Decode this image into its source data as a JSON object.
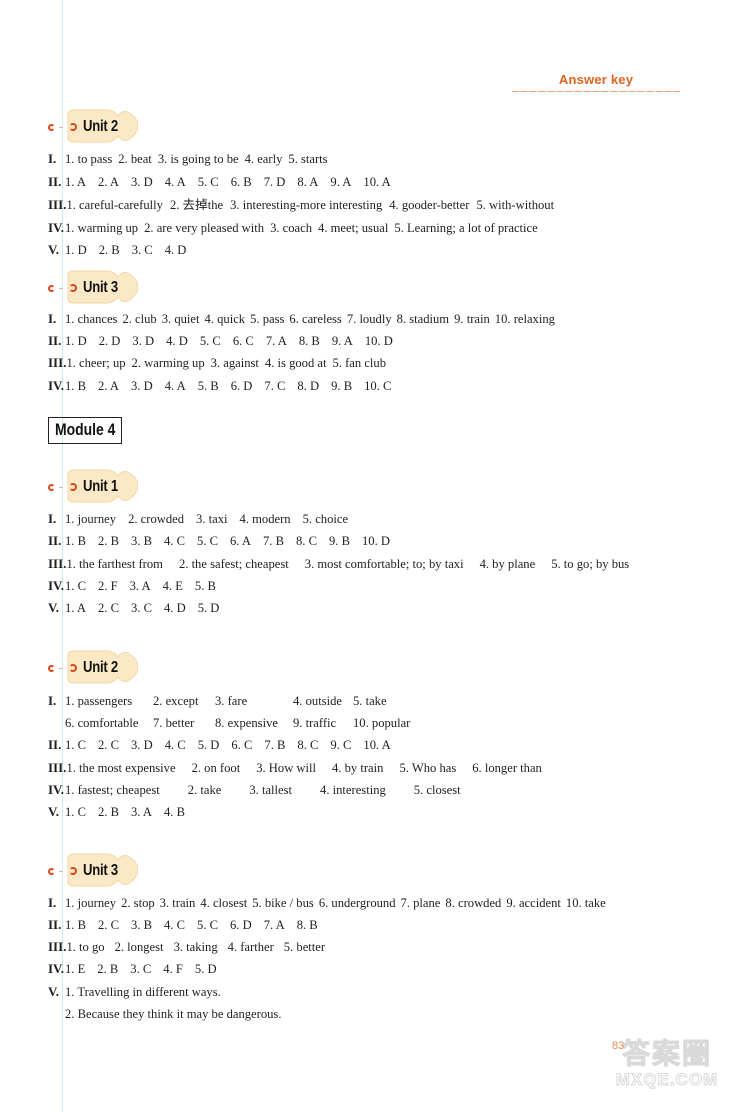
{
  "header": {
    "title": "Answer key"
  },
  "page_number": "83",
  "watermark": {
    "cn": "答案圈",
    "en": "MXQE.COM"
  },
  "module3_tail": {
    "unit2": {
      "title": "Unit 2",
      "sections": [
        {
          "numeral": "I.",
          "items": [
            "1. to pass",
            "2. beat",
            "3. is going to be",
            "4. early",
            "5. starts"
          ]
        },
        {
          "numeral": "II.",
          "items": [
            "1. A",
            "2. A",
            "3. D",
            "4. A",
            "5. C",
            "6. B",
            "7. D",
            "8. A",
            "9. A",
            "10. A"
          ]
        },
        {
          "numeral": "III.",
          "items": [
            "1. careful-carefully",
            "2. 去掉the",
            "3. interesting-more interesting",
            "4. gooder-better",
            "5. with-without"
          ]
        },
        {
          "numeral": "IV.",
          "items": [
            "1. warming up",
            "2. are very pleased with",
            "3. coach",
            "4. meet; usual",
            "5. Learning; a lot of practice"
          ]
        },
        {
          "numeral": "V.",
          "items": [
            "1. D",
            "2. B",
            "3. C",
            "4. D"
          ]
        }
      ]
    },
    "unit3": {
      "title": "Unit 3",
      "sections": [
        {
          "numeral": "I.",
          "items": [
            "1. chances",
            "2. club",
            "3. quiet",
            "4. quick",
            "5. pass",
            "6. careless",
            "7. loudly",
            "8. stadium",
            "9. train",
            "10. relaxing"
          ]
        },
        {
          "numeral": "II.",
          "items": [
            "1. D",
            "2. D",
            "3. D",
            "4. D",
            "5. C",
            "6. C",
            "7. A",
            "8. B",
            "9. A",
            "10. D"
          ]
        },
        {
          "numeral": "III.",
          "items": [
            "1. cheer; up",
            "2. warming up",
            "3. against",
            "4. is good at",
            "5. fan club"
          ]
        },
        {
          "numeral": "IV.",
          "items": [
            "1. B",
            "2. A",
            "3. D",
            "4. A",
            "5. B",
            "6. D",
            "7. C",
            "8. D",
            "9. B",
            "10. C"
          ]
        }
      ]
    }
  },
  "module4": {
    "title": "Module 4",
    "unit1": {
      "title": "Unit 1",
      "sections": [
        {
          "numeral": "I.",
          "items": [
            "1. journey",
            "2. crowded",
            "3. taxi",
            "4. modern",
            "5. choice"
          ]
        },
        {
          "numeral": "II.",
          "items": [
            "1. B",
            "2. B",
            "3. B",
            "4. C",
            "5. C",
            "6. A",
            "7. B",
            "8. C",
            "9. B",
            "10. D"
          ]
        },
        {
          "numeral": "III.",
          "items": [
            "1. the farthest from",
            "2. the safest; cheapest",
            "3. most comfortable; to; by taxi",
            "4. by plane",
            "5. to go; by bus"
          ]
        },
        {
          "numeral": "IV.",
          "items": [
            "1. C",
            "2. F",
            "3. A",
            "4. E",
            "5. B"
          ]
        },
        {
          "numeral": "V.",
          "items": [
            "1. A",
            "2. C",
            "3. C",
            "4. D",
            "5. D"
          ]
        }
      ]
    },
    "unit2": {
      "title": "Unit 2",
      "sections": [
        {
          "numeral": "I.",
          "items": [
            "1. passengers",
            "2. except",
            "3. fare",
            "4. outside",
            "5. take"
          ]
        },
        {
          "numeral": "",
          "items": [
            "6. comfortable",
            "7. better",
            "8. expensive",
            "9. traffic",
            "10. popular"
          ]
        },
        {
          "numeral": "II.",
          "items": [
            "1. C",
            "2. C",
            "3. D",
            "4. C",
            "5. D",
            "6. C",
            "7. B",
            "8. C",
            "9. C",
            "10. A"
          ]
        },
        {
          "numeral": "III.",
          "items": [
            "1. the most expensive",
            "2. on foot",
            "3. How will",
            "4. by train",
            "5. Who has",
            "6. longer than"
          ]
        },
        {
          "numeral": "IV.",
          "items": [
            "1. fastest; cheapest",
            "2. take",
            "3. tallest",
            "4. interesting",
            "5. closest"
          ]
        },
        {
          "numeral": "V.",
          "items": [
            "1. C",
            "2. B",
            "3. A",
            "4. B"
          ]
        }
      ]
    },
    "unit3": {
      "title": "Unit 3",
      "sections": [
        {
          "numeral": "I.",
          "items": [
            "1. journey",
            "2. stop",
            "3. train",
            "4. closest",
            "5. bike / bus",
            "6. underground",
            "7. plane",
            "8. crowded",
            "9. accident",
            "10. take"
          ]
        },
        {
          "numeral": "II.",
          "items": [
            "1. B",
            "2. C",
            "3. B",
            "4. C",
            "5. C",
            "6. D",
            "7. A",
            "8. B"
          ]
        },
        {
          "numeral": "III.",
          "items": [
            "1. to go",
            "2. longest",
            "3. taking",
            "4. farther",
            "5. better"
          ]
        },
        {
          "numeral": "IV.",
          "items": [
            "1. E",
            "2. B",
            "3. C",
            "4. F",
            "5. D"
          ]
        },
        {
          "numeral": "V.",
          "items": [
            "1. Travelling in different ways."
          ]
        },
        {
          "numeral": "",
          "items": [
            "2. Because they think it may be dangerous."
          ]
        }
      ]
    }
  }
}
